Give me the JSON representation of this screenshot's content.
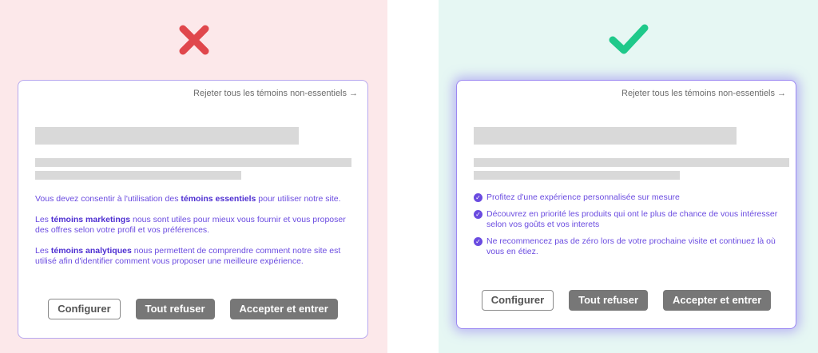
{
  "colors": {
    "bad_background": "#fce8ea",
    "good_background": "#e6f7f3",
    "cross": "#e0474c",
    "check": "#1fc98a",
    "accent_text": "#6a4be0",
    "button_grey": "#777777"
  },
  "bad_example": {
    "status_icon": "cross-icon",
    "reject_link": "Rejeter tous les témoins non-essentiels",
    "reject_arrow": "→",
    "paragraphs": [
      {
        "before": "Vous devez consentir à l'utilisation des ",
        "bold": "témoins essentiels",
        "after": " pour utiliser notre site."
      },
      {
        "before": "Les ",
        "bold": "témoins marketings",
        "after": " nous sont utiles pour mieux vous fournir et vous proposer des offres selon votre profil et vos préférences."
      },
      {
        "before": "Les ",
        "bold": "témoins analytiques",
        "after": " nous permettent de comprendre comment notre site est utilisé afin d'identifier comment vous proposer une meilleure expérience."
      }
    ],
    "buttons": {
      "configure": "Configurer",
      "refuse_all": "Tout refuser",
      "accept": "Accepter et entrer"
    }
  },
  "good_example": {
    "status_icon": "checkmark-icon",
    "reject_link": "Rejeter tous les témoins non-essentiels",
    "reject_arrow": "→",
    "benefits": [
      "Profitez d'une expérience personnalisée sur mesure",
      "Découvrez en priorité les produits qui ont le plus de chance de vous intéresser selon vos goûts et vos interets",
      "Ne recommencez pas de zéro lors de votre prochaine visite et continuez là où vous en étiez."
    ],
    "buttons": {
      "configure": "Configurer",
      "refuse_all": "Tout refuser",
      "accept": "Accepter et entrer"
    }
  }
}
